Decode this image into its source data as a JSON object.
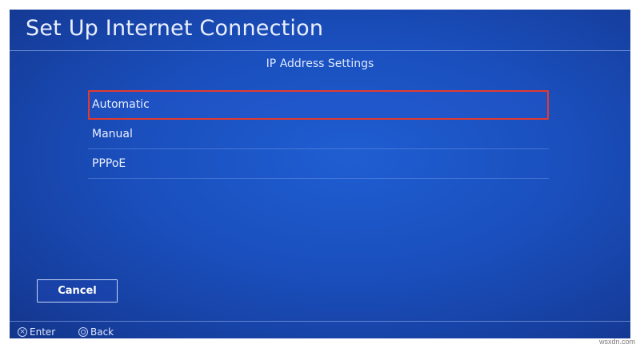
{
  "screen": {
    "title": "Set Up Internet Connection",
    "subtitle": "IP Address Settings"
  },
  "options": [
    {
      "label": "Automatic",
      "selected": true
    },
    {
      "label": "Manual",
      "selected": false
    },
    {
      "label": "PPPoE",
      "selected": false
    }
  ],
  "buttons": {
    "cancel": "Cancel"
  },
  "footer": {
    "enter_label": "Enter",
    "enter_glyph": "×",
    "back_label": "Back"
  },
  "colors": {
    "background": "#1a4fbd",
    "highlight_border": "#e23a2e"
  },
  "watermark": "wsxdn.com"
}
